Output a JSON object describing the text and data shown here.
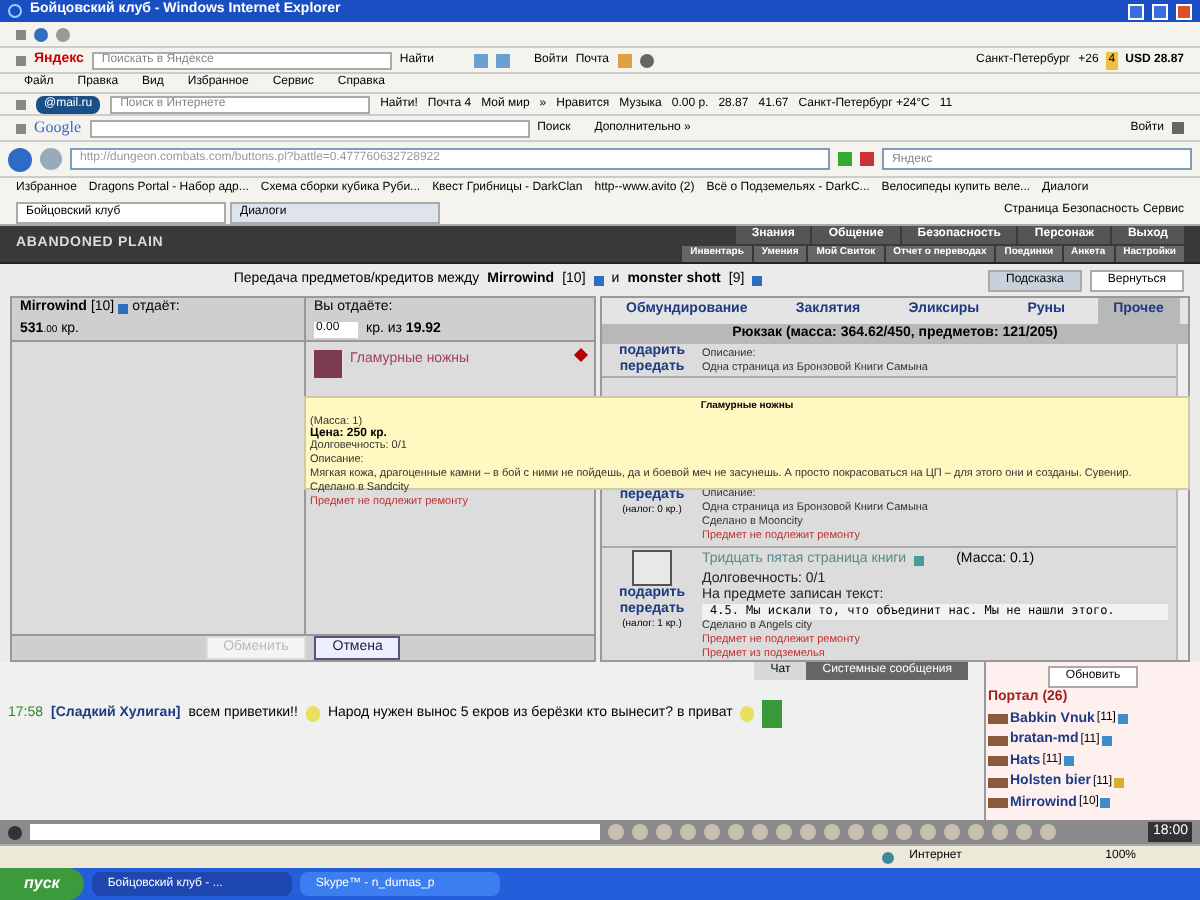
{
  "window": {
    "title": "Бойцовский клуб - Windows Internet Explorer"
  },
  "yandex_bar": {
    "logo": "Яндекс",
    "placeholder": "Поискать в Яндексе",
    "search": "Найти",
    "login": "Войти",
    "mail": "Почта",
    "city": "Санкт-Петербург",
    "temp": "+26",
    "traffic": "4",
    "rate": "USD 28.87"
  },
  "menu": [
    "Файл",
    "Правка",
    "Вид",
    "Избранное",
    "Сервис",
    "Справка"
  ],
  "mail_bar": {
    "logo": "@mail.ru",
    "placeholder": "Поиск в Интернете",
    "search": "Найти!",
    "items": [
      "Почта 4",
      "Мой мир",
      "»",
      "Нравится",
      "Музыка",
      "0.00 р.",
      "28.87",
      "41.67",
      "Санкт-Петербург +24°C",
      "11"
    ]
  },
  "google_bar": {
    "logo": "Google",
    "search": "Поиск",
    "more": "Дополнительно »",
    "login": "Войти"
  },
  "address": {
    "url": "http://dungeon.combats.com/buttons.pl?battle=0.477760632728922",
    "search_placeholder": "Яндекс"
  },
  "favorites": {
    "label": "Избранное",
    "items": [
      "Dragons Portal - Набор адр...",
      "Схема сборки кубика Руби...",
      "Квест Грибницы - DarkClan",
      "http--www.avito (2)",
      "Всё о Подземельях - DarkC...",
      "Велосипеды купить веле...",
      "Диалоги"
    ]
  },
  "tabs": [
    {
      "label": "Бойцовский клуб",
      "selected": true
    },
    {
      "label": "Диалоги",
      "selected": false
    }
  ],
  "command_bar": [
    "Страница",
    "Безопасность",
    "Сервис"
  ],
  "game": {
    "logo": "ABANDONED PLAIN",
    "nav": [
      "Знания",
      "Общение",
      "Безопасность",
      "Персонаж",
      "Выход"
    ],
    "subnav": [
      "Инвентарь",
      "Умения",
      "Мой Свиток",
      "Отчет о переводах",
      "Поединки",
      "Анкета",
      "Настройки"
    ],
    "trade": {
      "heading": "Передача предметов/кредитов между",
      "user1": {
        "name": "Mirrowind",
        "level": "[10]"
      },
      "conj": "и",
      "user2": {
        "name": "monster shott",
        "level": "[9]"
      },
      "buttons": [
        "Подсказка",
        "Вернуться"
      ],
      "their_side": {
        "name": "Mirrowind",
        "level": "[10]",
        "verb": "отдаёт:",
        "amount": "531",
        "cents": ".00",
        "unit": "кр."
      },
      "your_side": {
        "header": "Вы отдаёте:",
        "value": "0.00",
        "of": "кр. из",
        "balance": "19.92",
        "item": "Гламурные ножны"
      },
      "actions": [
        {
          "label": "Обменить",
          "disabled": true
        },
        {
          "label": "Отмена",
          "disabled": false
        }
      ]
    },
    "inventory": {
      "tabs": [
        {
          "label": "Обмундирование",
          "selected": false
        },
        {
          "label": "Заклятия",
          "selected": false
        },
        {
          "label": "Эликсиры",
          "selected": false
        },
        {
          "label": "Руны",
          "selected": false
        },
        {
          "label": "Прочее",
          "selected": true
        }
      ],
      "title": "Рюкзак (масса: 364.62/450, предметов: 121/205)",
      "items": [
        {
          "links": [
            "подарить",
            "передать"
          ],
          "lines": [
            {
              "kind": "plain",
              "text": "Описание:"
            },
            {
              "kind": "plain",
              "text": "Одна страница из Бронзовой Книги Самына"
            }
          ]
        },
        {
          "links": [
            "передать"
          ],
          "tax": "(налог: 0 кр.)",
          "lines": [
            {
              "kind": "plain",
              "text": "Описание:"
            },
            {
              "kind": "plain",
              "text": "Одна страница из Бронзовой Книги Самына"
            },
            {
              "kind": "plain",
              "text": "Сделано в Mooncity"
            },
            {
              "kind": "warn",
              "text": "Предмет не подлежит ремонту"
            }
          ]
        },
        {
          "name": "Тридцать пятая страница книги",
          "mass": "(Масса: 0.1)",
          "links": [
            "подарить",
            "передать"
          ],
          "tax": "(налог: 1 кр.)",
          "lines": [
            {
              "kind": "large",
              "text": "Долговечность: 0/1"
            },
            {
              "kind": "large",
              "text": "На предмете записан текст:"
            },
            {
              "kind": "mono",
              "text": "4.5. Мы искали то, что объединит нас. Мы не нашли этого."
            },
            {
              "kind": "plain",
              "text": "Сделано в Angels city"
            },
            {
              "kind": "warn",
              "text": "Предмет не подлежит ремонту"
            },
            {
              "kind": "warn",
              "text": "Предмет из подземелья"
            }
          ]
        }
      ]
    },
    "tooltip": {
      "title": "Гламурные ножны",
      "lines": [
        {
          "kind": "plain",
          "text": "(Масса: 1)"
        },
        {
          "kind": "bold",
          "text": "Цена: 250 кр."
        },
        {
          "kind": "plain",
          "text": "Долговечность: 0/1"
        },
        {
          "kind": "plain",
          "text": "Описание:"
        },
        {
          "kind": "plain",
          "text": "Мягкая кожа, драгоценные камни – в бой с ними не пойдешь, да и боевой меч не засунешь. А просто покрасоваться на ЦП – для этого они и созданы. Сувенир."
        },
        {
          "kind": "plain",
          "text": "Сделано в Sandcity"
        },
        {
          "kind": "warn",
          "text": "Предмет не подлежит ремонту"
        }
      ]
    },
    "chat": {
      "tabs": [
        {
          "label": "Чат",
          "selected": true
        },
        {
          "label": "Системные сообщения",
          "selected": false
        }
      ],
      "time": "17:58",
      "author": "[Сладкий Хулиган]",
      "parts": [
        "всем приветики!!",
        "Народ нужен вынос 5 екров из берёзки кто вынесит? в приват"
      ],
      "refresh": "Обновить",
      "room": "Портал (26)",
      "users": [
        {
          "name": "Babkin Vnuk",
          "level": "[11]",
          "color": "#3a8fc8"
        },
        {
          "name": "bratan-md",
          "level": "[11]",
          "color": "#3a8fc8"
        },
        {
          "name": "Hats",
          "level": "[11]",
          "color": "#3a8fc8"
        },
        {
          "name": "Holsten bier",
          "level": "[11]",
          "color": "#d8b030"
        },
        {
          "name": "Mirrowind",
          "level": "[10]",
          "color": "#3a8fc8"
        }
      ],
      "clock": "18:00"
    }
  },
  "statusbar": {
    "zone": "Интернет",
    "zoom": "100%"
  },
  "taskbar": {
    "start": "пуск",
    "tasks": [
      {
        "label": "Бойцовский клуб - ...",
        "selected": true
      },
      {
        "label": "Skype™ - n_dumas_p",
        "selected": false
      }
    ]
  }
}
